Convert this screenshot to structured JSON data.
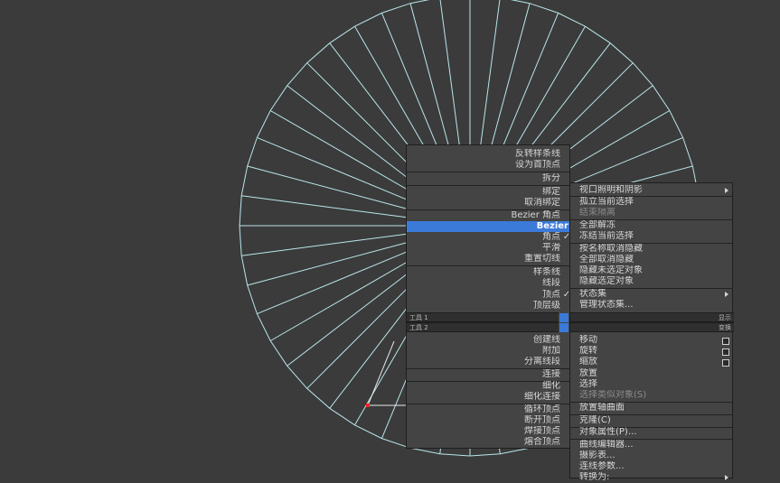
{
  "colors": {
    "background": "#3b3b3b",
    "menu": "#444444",
    "highlight": "#3c7ad9",
    "wire": "#b9e6ea",
    "vertex": "#ff2020"
  },
  "left_menu": {
    "items": [
      {
        "label": "反转样条线"
      },
      {
        "label": "设为首顶点"
      },
      {
        "label": "拆分"
      },
      {
        "label": "绑定"
      },
      {
        "label": "取消绑定"
      },
      {
        "label": "Bezier 角点"
      },
      {
        "label": "Bezier"
      },
      {
        "label": "角点"
      },
      {
        "label": "平滑"
      },
      {
        "label": "重置切线"
      },
      {
        "label": "样条线"
      },
      {
        "label": "线段"
      },
      {
        "label": "顶点"
      },
      {
        "label": "顶层级"
      },
      {
        "label": "创建线"
      },
      {
        "label": "附加"
      },
      {
        "label": "分离线段"
      },
      {
        "label": "连接"
      },
      {
        "label": "细化"
      },
      {
        "label": "细化连接"
      },
      {
        "label": "循环顶点"
      },
      {
        "label": "断开顶点"
      },
      {
        "label": "焊接顶点"
      },
      {
        "label": "熔合顶点"
      }
    ]
  },
  "right_menu": {
    "items": [
      {
        "label": "视口照明和阴影"
      },
      {
        "label": "孤立当前选择"
      },
      {
        "label": "结束隔离"
      },
      {
        "label": "全部解冻"
      },
      {
        "label": "冻结当前选择"
      },
      {
        "label": "按名称取消隐藏"
      },
      {
        "label": "全部取消隐藏"
      },
      {
        "label": "隐藏未选定对象"
      },
      {
        "label": "隐藏选定对象"
      },
      {
        "label": "状态集"
      },
      {
        "label": "管理状态集..."
      },
      {
        "label": "移动"
      },
      {
        "label": "旋转"
      },
      {
        "label": "缩放"
      },
      {
        "label": "放置"
      },
      {
        "label": "选择"
      },
      {
        "label": "选择类似对象(S)"
      },
      {
        "label": "放置轴曲面"
      },
      {
        "label": "克隆(C)"
      },
      {
        "label": "对象属性(P)..."
      },
      {
        "label": "曲线编辑器..."
      },
      {
        "label": "摄影表..."
      },
      {
        "label": "连线参数..."
      },
      {
        "label": "转换为:"
      }
    ]
  },
  "quad_bars": {
    "tools1": "工具 1",
    "tools2": "工具 2",
    "display": "显示",
    "transform": "变换"
  },
  "checkmark": "✓"
}
